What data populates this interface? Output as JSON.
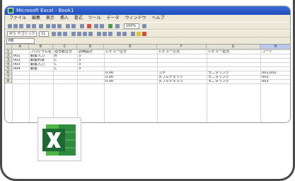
{
  "window": {
    "title": "Microsoft Excel - Book1"
  },
  "menu": [
    "ファイル",
    "編集",
    "表示",
    "挿入",
    "書式",
    "ツール",
    "データ",
    "ウィンドウ",
    "ヘルプ"
  ],
  "toolbar": {
    "font_name": "ＭＳ Ｐゴシック",
    "font_size": "11",
    "zoom": "100%"
  },
  "name_box": "H8",
  "columns": [
    "A",
    "B",
    "C",
    "D",
    "E",
    "F",
    "G",
    "H"
  ],
  "header_row": [
    "",
    "プログラム名",
    "担当者区分",
    "詳細設計",
    "レビュー区分",
    "レビュー方法",
    "レビュー担当者",
    "コード"
  ],
  "rows": [
    {
      "num": "1",
      "cells": [
        "",
        "プログラム名",
        "担当者区分",
        "詳細設計",
        "レビュー区分",
        "レビュー方法",
        "レビュー担当",
        "コード"
      ]
    },
    {
      "num": "2",
      "cells": [
        "001",
        "顧客入力",
        "B",
        "3",
        "",
        "",
        "",
        ""
      ]
    },
    {
      "num": "3",
      "cells": [
        "002",
        "顧客照会",
        "C",
        "3",
        "",
        "",
        "",
        ""
      ]
    },
    {
      "num": "4",
      "cells": [
        "003",
        "顧客入力",
        "C",
        "3",
        "",
        "",
        "",
        ""
      ]
    },
    {
      "num": "5",
      "cells": [
        "004",
        "顧客",
        "C",
        "3",
        "",
        "",
        "",
        ""
      ]
    },
    {
      "num": "6",
      "cells": [
        "",
        "",
        "",
        "",
        "0.00",
        "コメ",
        "モニタリング",
        "001,002"
      ]
    },
    {
      "num": "7",
      "cells": [
        "",
        "",
        "",
        "",
        "0.00",
        "ダブルチェック",
        "モニタリング",
        "003"
      ]
    },
    {
      "num": "8",
      "cells": [
        "",
        "",
        "",
        "",
        "0.00",
        "ダブルチェック",
        "モニタリング",
        "003"
      ]
    }
  ],
  "logo": {
    "name": "excel-logo-icon",
    "colors": {
      "dark": "#1d6b32",
      "light": "#4fb548",
      "x": "#ffffff"
    }
  }
}
